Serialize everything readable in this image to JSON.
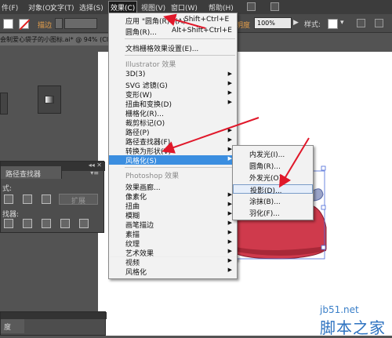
{
  "menubar": {
    "items": [
      {
        "label": "件(F)"
      },
      {
        "label": "对象(O)"
      },
      {
        "label": "文字(T)"
      },
      {
        "label": "选择(S)"
      },
      {
        "label": "效果(C)"
      },
      {
        "label": "视图(V)"
      },
      {
        "label": "窗口(W)"
      },
      {
        "label": "帮助(H)"
      }
    ]
  },
  "controlbar": {
    "stroke_label": "描边",
    "opacity_label": "明度",
    "opacity_value": "100%",
    "style_label": "样式:"
  },
  "document_tab": {
    "label": "会制爱心袋子的小图标.ai* @ 94% (CI"
  },
  "effect_menu": {
    "apply_last": {
      "label": "应用 \"圆角(R)\" (A)",
      "shortcut": "Shift+Ctrl+E"
    },
    "last_effect": {
      "label": "圆角(R)...",
      "shortcut": "Alt+Shift+Ctrl+E"
    },
    "raster_settings": {
      "label": "文档栅格效果设置(E)..."
    },
    "illustrator_header": "Illustrator 效果",
    "illustrator_items": [
      {
        "label": "3D(3)",
        "arrow": "▶"
      },
      {
        "label": "SVG 滤镜(G)",
        "arrow": "▶"
      },
      {
        "label": "变形(W)",
        "arrow": "▶"
      },
      {
        "label": "扭曲和变换(D)",
        "arrow": "▶"
      },
      {
        "label": "栅格化(R)...",
        "arrow": ""
      },
      {
        "label": "裁剪标记(O)",
        "arrow": ""
      },
      {
        "label": "路径(P)",
        "arrow": "▶"
      },
      {
        "label": "路径查找器(F)",
        "arrow": "▶"
      },
      {
        "label": "转换为形状(V)",
        "arrow": "▶"
      },
      {
        "label": "风格化(S)",
        "arrow": "▶"
      }
    ],
    "photoshop_header": "Photoshop 效果",
    "photoshop_items": [
      {
        "label": "效果画廊...",
        "arrow": ""
      },
      {
        "label": "像素化",
        "arrow": "▶"
      },
      {
        "label": "扭曲",
        "arrow": "▶"
      },
      {
        "label": "模糊",
        "arrow": "▶"
      },
      {
        "label": "画笔描边",
        "arrow": "▶"
      },
      {
        "label": "素描",
        "arrow": "▶"
      },
      {
        "label": "纹理",
        "arrow": "▶"
      },
      {
        "label": "艺术效果",
        "arrow": "▶"
      },
      {
        "label": "视频",
        "arrow": "▶"
      },
      {
        "label": "风格化",
        "arrow": "▶"
      }
    ]
  },
  "stylize_submenu": {
    "items": [
      {
        "label": "内发光(I)..."
      },
      {
        "label": "圆角(R)..."
      },
      {
        "label": "外发光(O)..."
      },
      {
        "label": "投影(D)..."
      },
      {
        "label": "涂抹(B)..."
      },
      {
        "label": "羽化(F)..."
      }
    ]
  },
  "pathfinder_panel": {
    "title": "路径查找器",
    "shape_modes_label": "式:",
    "pathfinders_label": "找器:",
    "expand_label": "扩展"
  },
  "bottom_panel": {
    "tab": "度"
  },
  "watermark": {
    "url": "jb51.net",
    "name": "脚本之家"
  },
  "colors": {
    "menubar": "#3c3c3c",
    "highlight": "#3b8ee0",
    "bag_fill": "#cf3a4c",
    "arrow": "#e0182a",
    "watermark": "#2d72c0"
  }
}
